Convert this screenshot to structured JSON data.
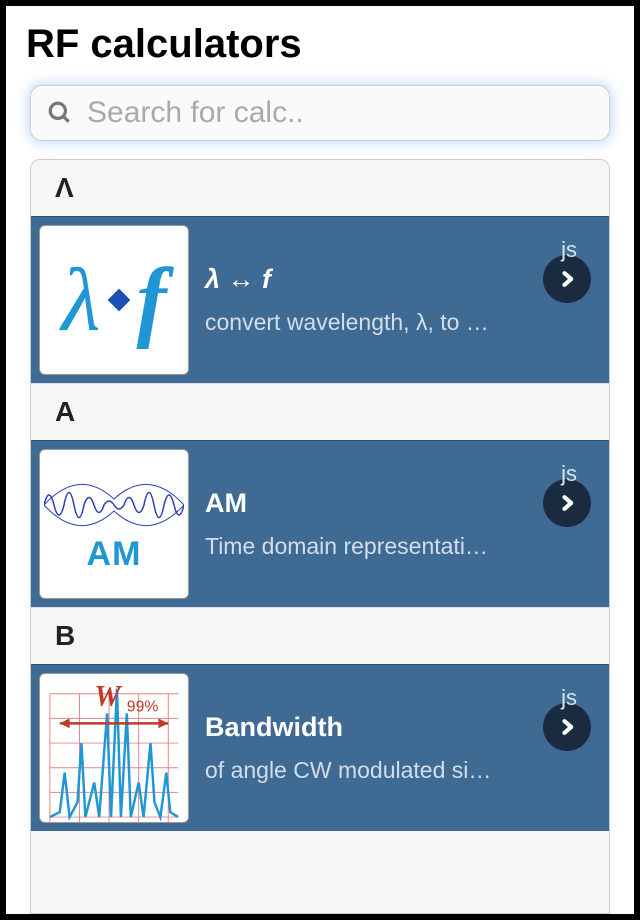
{
  "header": {
    "title": "RF calculators"
  },
  "search": {
    "placeholder": "Search for calc.."
  },
  "sections": [
    {
      "letter": "Λ",
      "items": [
        {
          "title": "λ ↔ f",
          "desc": "convert wavelength, λ, to …",
          "tag": "js",
          "thumb": "lambda-f"
        }
      ]
    },
    {
      "letter": "A",
      "items": [
        {
          "title": "AM",
          "desc": "Time domain representati…",
          "tag": "js",
          "thumb": "am"
        }
      ]
    },
    {
      "letter": "B",
      "items": [
        {
          "title": "Bandwidth",
          "desc": "of angle CW modulated si…",
          "tag": "js",
          "thumb": "bandwidth"
        }
      ]
    }
  ]
}
